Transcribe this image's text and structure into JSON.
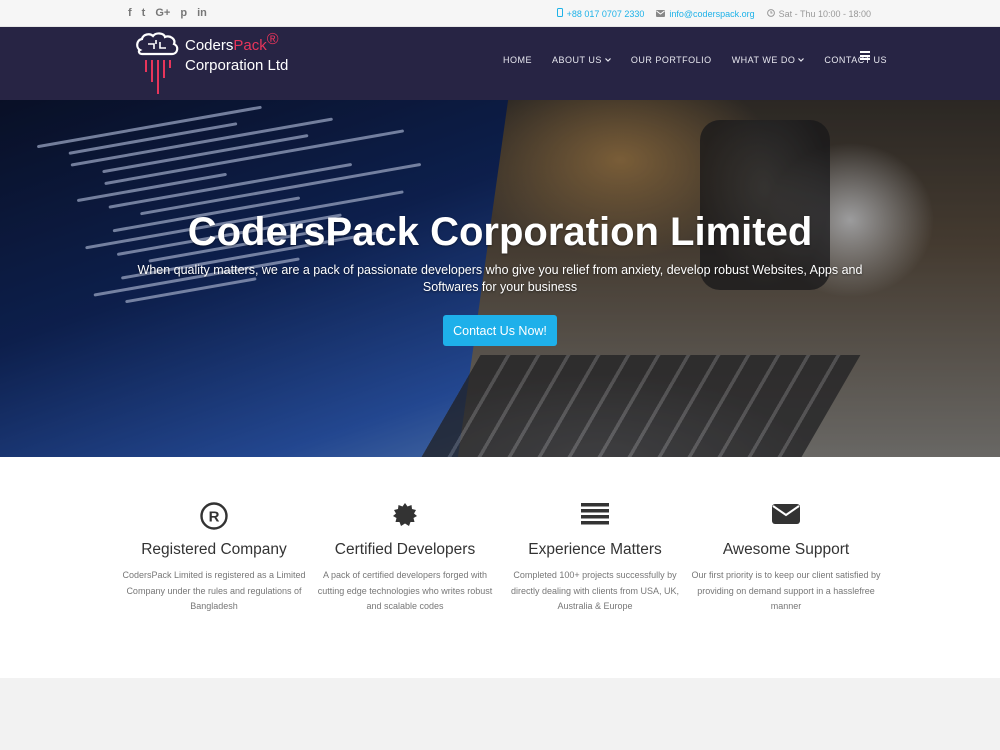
{
  "topbar": {
    "social_icons": [
      "facebook-icon",
      "twitter-icon",
      "google-plus-icon",
      "pinterest-icon",
      "linkedin-icon"
    ],
    "social_glyphs": [
      "f",
      "t",
      "G+",
      "p",
      "in"
    ],
    "phone": "+88 017 0707 2330",
    "email": "info@coderspack.org",
    "hours": "Sat - Thu 10:00 - 18:00"
  },
  "brand": {
    "name_part1": "Coders",
    "name_part2": "Pack",
    "registered_mark": "®",
    "line2": "Corporation Ltd"
  },
  "nav": {
    "items": [
      {
        "label": "HOME",
        "dropdown": false
      },
      {
        "label": "ABOUT US",
        "dropdown": true
      },
      {
        "label": "OUR PORTFOLIO",
        "dropdown": false
      },
      {
        "label": "WHAT WE DO",
        "dropdown": true
      },
      {
        "label": "CONTACT US",
        "dropdown": false
      }
    ],
    "caret": "⌄"
  },
  "hero": {
    "title": "CodersPack Corporation Limited",
    "subtitle": "When quality matters, we are a pack of passionate developers who give you relief from anxiety, develop robust Websites, Apps and Softwares for your business",
    "cta": "Contact Us Now!"
  },
  "features": [
    {
      "icon": "registered-icon",
      "title": "Registered Company",
      "desc": "CodersPack Limited is registered as a Limited Company under the rules and regulations of Bangladesh"
    },
    {
      "icon": "certificate-icon",
      "title": "Certified Developers",
      "desc": "A pack of certified developers forged with cutting edge technologies who writes robust and scalable codes"
    },
    {
      "icon": "list-icon",
      "title": "Experience Matters",
      "desc": "Completed 100+ projects successfully by directly dealing with clients from USA, UK, Australia & Europe"
    },
    {
      "icon": "envelope-icon",
      "title": "Awesome Support",
      "desc": "Our first priority is to keep our client satisfied by providing on demand support in a hasslefree manner"
    }
  ],
  "colors": {
    "navbar_bg": "#272444",
    "accent": "#1eb0ea",
    "brand_red": "#e8355b"
  }
}
